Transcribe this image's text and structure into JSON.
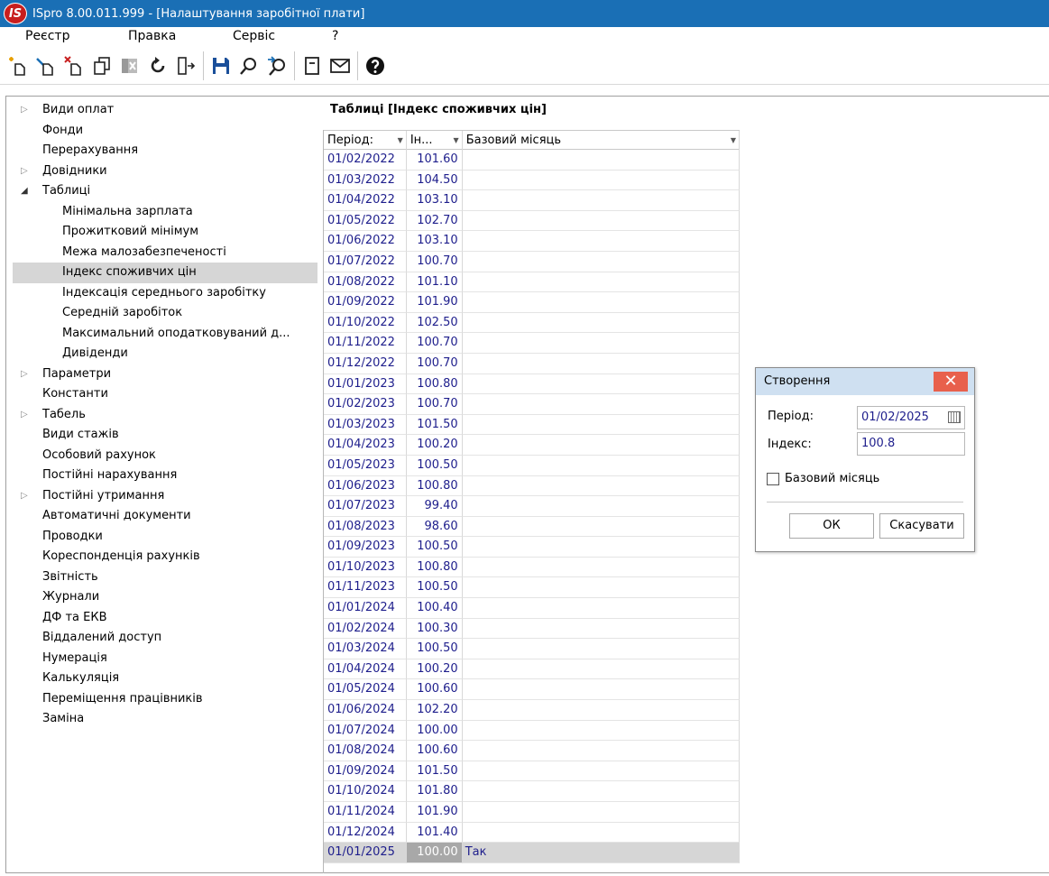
{
  "window": {
    "logo_text": "IS",
    "title": "ISpro 8.00.011.999 - [Налаштування заробітної плати]"
  },
  "menu": [
    "Реєстр",
    "Правка",
    "Сервіс",
    "?"
  ],
  "toolbar": {
    "icons": [
      "new-icon",
      "edit-icon",
      "delete-icon",
      "copy-icon",
      "batch-delete-icon",
      "refresh-icon",
      "exit-icon",
      "save-icon",
      "search-icon",
      "find-next-icon",
      "document-icon",
      "mail-icon",
      "help-icon"
    ]
  },
  "tree": {
    "items": [
      {
        "label": "Види оплат",
        "level": 0,
        "arrow": "collapsed"
      },
      {
        "label": "Фонди",
        "level": 0,
        "arrow": ""
      },
      {
        "label": "Перерахування",
        "level": 0,
        "arrow": ""
      },
      {
        "label": "Довідники",
        "level": 0,
        "arrow": "collapsed"
      },
      {
        "label": "Таблиці",
        "level": 0,
        "arrow": "expanded"
      },
      {
        "label": "Мінімальна зарплата",
        "level": 1,
        "arrow": ""
      },
      {
        "label": "Прожитковий мінімум",
        "level": 1,
        "arrow": ""
      },
      {
        "label": "Межа малозабезпеченості",
        "level": 1,
        "arrow": ""
      },
      {
        "label": "Індекс споживчих цін",
        "level": 1,
        "arrow": "",
        "selected": true
      },
      {
        "label": "Індексація середнього заробітку",
        "level": 1,
        "arrow": ""
      },
      {
        "label": "Середній заробіток",
        "level": 1,
        "arrow": ""
      },
      {
        "label": "Максимальний оподатковуваний д...",
        "level": 1,
        "arrow": ""
      },
      {
        "label": "Дивіденди",
        "level": 1,
        "arrow": ""
      },
      {
        "label": "Параметри",
        "level": 0,
        "arrow": "collapsed"
      },
      {
        "label": "Константи",
        "level": 0,
        "arrow": ""
      },
      {
        "label": "Табель",
        "level": 0,
        "arrow": "collapsed"
      },
      {
        "label": "Види стажів",
        "level": 0,
        "arrow": ""
      },
      {
        "label": "Особовий рахунок",
        "level": 0,
        "arrow": ""
      },
      {
        "label": "Постійні нарахування",
        "level": 0,
        "arrow": ""
      },
      {
        "label": "Постійні утримання",
        "level": 0,
        "arrow": "collapsed"
      },
      {
        "label": "Автоматичні документи",
        "level": 0,
        "arrow": ""
      },
      {
        "label": "Проводки",
        "level": 0,
        "arrow": ""
      },
      {
        "label": "Кореспонденція рахунків",
        "level": 0,
        "arrow": ""
      },
      {
        "label": "Звітність",
        "level": 0,
        "arrow": ""
      },
      {
        "label": "Журнали",
        "level": 0,
        "arrow": ""
      },
      {
        "label": "ДФ та ЕКВ",
        "level": 0,
        "arrow": ""
      },
      {
        "label": "Віддалений доступ",
        "level": 0,
        "arrow": ""
      },
      {
        "label": "Нумерація",
        "level": 0,
        "arrow": ""
      },
      {
        "label": "Калькуляція",
        "level": 0,
        "arrow": ""
      },
      {
        "label": "Переміщення працівників",
        "level": 0,
        "arrow": ""
      },
      {
        "label": "Заміна",
        "level": 0,
        "arrow": ""
      }
    ]
  },
  "table": {
    "title": "Таблиці [Індекс споживчих цін]",
    "columns": [
      "Період:",
      "Ін...",
      "Базовий місяць"
    ],
    "rows": [
      [
        "01/02/2022",
        "101.60",
        ""
      ],
      [
        "01/03/2022",
        "104.50",
        ""
      ],
      [
        "01/04/2022",
        "103.10",
        ""
      ],
      [
        "01/05/2022",
        "102.70",
        ""
      ],
      [
        "01/06/2022",
        "103.10",
        ""
      ],
      [
        "01/07/2022",
        "100.70",
        ""
      ],
      [
        "01/08/2022",
        "101.10",
        ""
      ],
      [
        "01/09/2022",
        "101.90",
        ""
      ],
      [
        "01/10/2022",
        "102.50",
        ""
      ],
      [
        "01/11/2022",
        "100.70",
        ""
      ],
      [
        "01/12/2022",
        "100.70",
        ""
      ],
      [
        "01/01/2023",
        "100.80",
        ""
      ],
      [
        "01/02/2023",
        "100.70",
        ""
      ],
      [
        "01/03/2023",
        "101.50",
        ""
      ],
      [
        "01/04/2023",
        "100.20",
        ""
      ],
      [
        "01/05/2023",
        "100.50",
        ""
      ],
      [
        "01/06/2023",
        "100.80",
        ""
      ],
      [
        "01/07/2023",
        "99.40",
        ""
      ],
      [
        "01/08/2023",
        "98.60",
        ""
      ],
      [
        "01/09/2023",
        "100.50",
        ""
      ],
      [
        "01/10/2023",
        "100.80",
        ""
      ],
      [
        "01/11/2023",
        "100.50",
        ""
      ],
      [
        "01/01/2024",
        "100.40",
        ""
      ],
      [
        "01/02/2024",
        "100.30",
        ""
      ],
      [
        "01/03/2024",
        "100.50",
        ""
      ],
      [
        "01/04/2024",
        "100.20",
        ""
      ],
      [
        "01/05/2024",
        "100.60",
        ""
      ],
      [
        "01/06/2024",
        "102.20",
        ""
      ],
      [
        "01/07/2024",
        "100.00",
        ""
      ],
      [
        "01/08/2024",
        "100.60",
        ""
      ],
      [
        "01/09/2024",
        "101.50",
        ""
      ],
      [
        "01/10/2024",
        "101.80",
        ""
      ],
      [
        "01/11/2024",
        "101.90",
        ""
      ],
      [
        "01/12/2024",
        "101.40",
        ""
      ],
      [
        "01/01/2025",
        "100.00",
        "Так"
      ]
    ],
    "selected_row": 34
  },
  "dialog": {
    "title": "Створення",
    "close_label": "✕",
    "period_label": "Період:",
    "period_value": "01/02/2025",
    "index_label": "Індекс:",
    "index_value": "100.8",
    "base_month_label": "Базовий місяць",
    "base_month_checked": false,
    "ok_label": "ОК",
    "cancel_label": "Скасувати"
  }
}
